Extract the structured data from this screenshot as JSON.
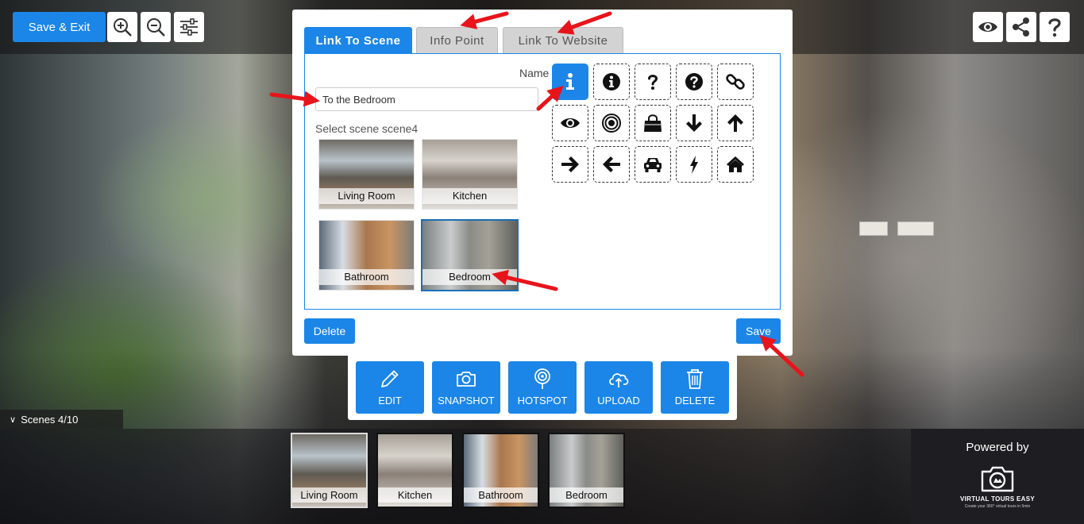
{
  "toolbar": {
    "save_exit_label": "Save & Exit",
    "zoom_in_icon": "zoom-in-icon",
    "zoom_out_icon": "zoom-out-icon",
    "settings_icon": "sliders-icon"
  },
  "top_right": {
    "preview_icon": "eye-icon",
    "share_icon": "share-icon",
    "help_icon": "question-icon"
  },
  "modal": {
    "tabs": [
      {
        "label": "Link To Scene",
        "active": true
      },
      {
        "label": "Info Point",
        "active": false
      },
      {
        "label": "Link To Website",
        "active": false
      }
    ],
    "name_label": "Name",
    "name_value": "To the Bedroom",
    "select_scene_label": "Select scene scene4",
    "scenes": [
      {
        "label": "Living Room",
        "selected": false
      },
      {
        "label": "Kitchen",
        "selected": false
      },
      {
        "label": "Bathroom",
        "selected": false
      },
      {
        "label": "Bedroom",
        "selected": true
      }
    ],
    "icons": [
      "info-i-icon",
      "info-circle-icon",
      "question-icon",
      "question-circle-icon",
      "link-icon",
      "eye-icon",
      "target-icon",
      "shopping-bag-icon",
      "arrow-down-icon",
      "arrow-up-icon",
      "arrow-right-icon",
      "arrow-left-icon",
      "car-icon",
      "bolt-icon",
      "home-icon"
    ],
    "selected_icon": "info-i-icon",
    "delete_label": "Delete",
    "save_label": "Save"
  },
  "actions": [
    {
      "label": "EDIT",
      "icon": "pencil-icon"
    },
    {
      "label": "SNAPSHOT",
      "icon": "camera-icon"
    },
    {
      "label": "HOTSPOT",
      "icon": "hotspot-pin-icon"
    },
    {
      "label": "UPLOAD",
      "icon": "cloud-upload-icon"
    },
    {
      "label": "DELETE",
      "icon": "trash-icon"
    }
  ],
  "scenes_bar": {
    "toggle_label": "Scenes 4/10",
    "items": [
      {
        "label": "Living Room",
        "active": true
      },
      {
        "label": "Kitchen",
        "active": false
      },
      {
        "label": "Bathroom",
        "active": false
      },
      {
        "label": "Bedroom",
        "active": false
      }
    ]
  },
  "powered": {
    "text": "Powered by",
    "brand": "VIRTUAL TOURS EASY",
    "tagline": "Create your 360° virtual tours in 5min"
  },
  "colors": {
    "accent": "#1b86e8",
    "annotation": "#e8141b"
  }
}
